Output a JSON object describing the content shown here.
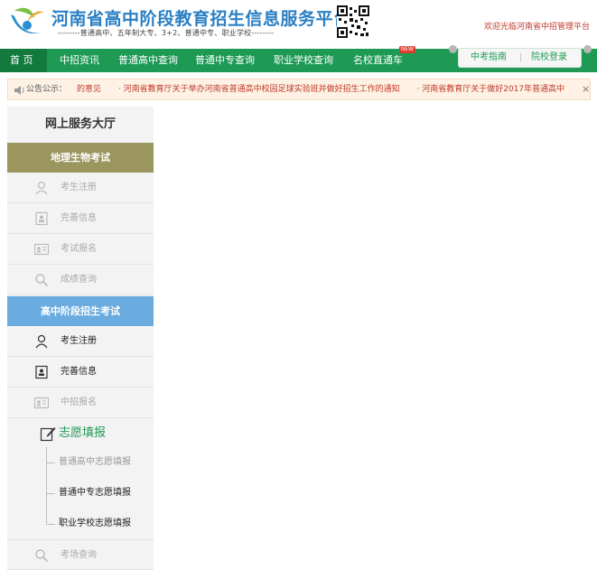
{
  "header": {
    "title": "河南省高中阶段教育招生信息服务平台",
    "subtitle": "--------普通高中、五年制大专、3+2、普通中专、职业学校--------",
    "welcome": "欢迎光临河南省中招管理平台"
  },
  "nav": {
    "items": [
      {
        "label": "首 页"
      },
      {
        "label": "中招资讯"
      },
      {
        "label": "普通高中查询"
      },
      {
        "label": "普通中专查询"
      },
      {
        "label": "职业学校查询"
      },
      {
        "label": "名校直通车"
      }
    ],
    "hot_badge": "NEW",
    "guide": "中考指南",
    "divider": "|",
    "login": "院校登录"
  },
  "notice": {
    "label": "公告公示：",
    "items": [
      "的意见",
      "· 河南省教育厅关于举办河南省普通高中校园足球实验班并做好招生工作的通知",
      "· 河南省教育厅关于做好2017年普通高中"
    ],
    "close": "×"
  },
  "sidebar": {
    "title": "网上服务大厅",
    "section1": {
      "header": "地理生物考试",
      "items": [
        {
          "label": "考生注册",
          "icon": "user-icon"
        },
        {
          "label": "完善信息",
          "icon": "profile-card-icon"
        },
        {
          "label": "考试报名",
          "icon": "id-card-icon"
        },
        {
          "label": "成绩查询",
          "icon": "search-icon"
        }
      ]
    },
    "section2": {
      "header": "高中阶段招生考试",
      "items": [
        {
          "label": "考生注册",
          "icon": "user-icon"
        },
        {
          "label": "完善信息",
          "icon": "profile-card-icon"
        },
        {
          "label": "中招报名",
          "icon": "id-card-icon"
        }
      ],
      "wish": {
        "label": "志愿填报",
        "icon": "edit-icon",
        "children": [
          {
            "label": "普通高中志愿填报"
          },
          {
            "label": "普通中专志愿填报"
          },
          {
            "label": "职业学校志愿填报"
          }
        ]
      },
      "last": {
        "label": "考场查询",
        "icon": "search-icon"
      }
    }
  },
  "colors": {
    "nav_green": "#1e9a54",
    "section_olive": "#9b955e",
    "section_blue": "#6aace0",
    "notice_red": "#c0392b"
  }
}
